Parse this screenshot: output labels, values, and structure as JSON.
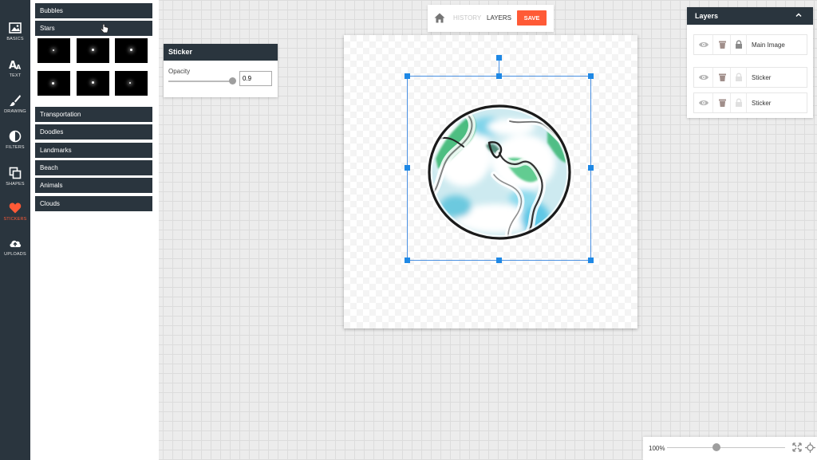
{
  "rail": {
    "tools": [
      {
        "label": "BASICS",
        "icon": "image-icon",
        "active": false
      },
      {
        "label": "TEXT",
        "icon": "text-icon",
        "active": false
      },
      {
        "label": "DRAWING",
        "icon": "brush-icon",
        "active": false
      },
      {
        "label": "FILTERS",
        "icon": "filter-icon",
        "active": false
      },
      {
        "label": "SHAPES",
        "icon": "shapes-icon",
        "active": false
      },
      {
        "label": "STICKERS",
        "icon": "heart-icon",
        "active": true
      },
      {
        "label": "UPLOADS",
        "icon": "cloud-upload-icon",
        "active": false
      }
    ]
  },
  "categories": {
    "items": [
      "Bubbles",
      "Stars",
      "Transportation",
      "Doodles",
      "Landmarks",
      "Beach",
      "Animals",
      "Clouds"
    ]
  },
  "sticker_panel": {
    "title": "Sticker",
    "opacity_label": "Opacity",
    "opacity_value": "0.9",
    "opacity_level": 0.9
  },
  "toolbar": {
    "history_label": "HISTORY",
    "layers_label": "LAYERS",
    "save_label": "SAVE"
  },
  "layers_panel": {
    "title": "Layers",
    "layers": [
      {
        "name": "Main Image",
        "locked": true
      },
      {
        "name": "Sticker",
        "locked": false
      },
      {
        "name": "Sticker",
        "locked": false
      }
    ]
  },
  "zoom": {
    "label": "100%",
    "level": 0.42
  },
  "colors": {
    "dark": "#2a353e",
    "accent": "#ff5a36",
    "handle": "#1e88e5"
  }
}
